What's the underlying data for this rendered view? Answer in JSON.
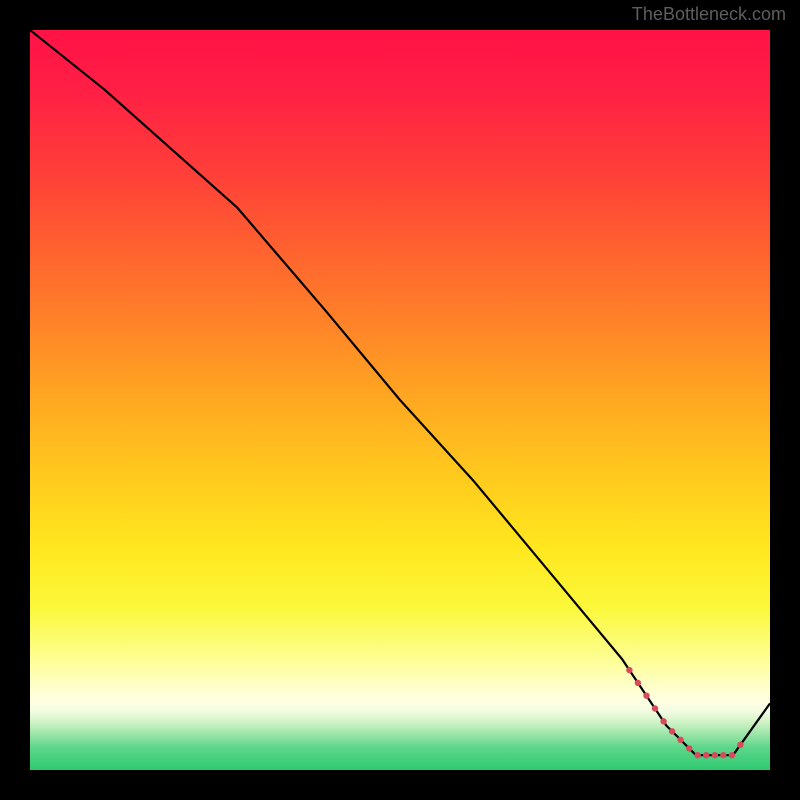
{
  "watermark": "TheBottleneck.com",
  "chart_data": {
    "type": "line",
    "title": "",
    "xlabel": "",
    "ylabel": "",
    "xlim": [
      0,
      100
    ],
    "ylim": [
      0,
      100
    ],
    "note": "Axes unlabeled; values are normalized percentages estimated from pixel positions. Gradient background runs from red (top, high value / high bottleneck) to green (bottom, low value / optimal).",
    "x": [
      0,
      10,
      28,
      40,
      50,
      60,
      70,
      80,
      86,
      90,
      95,
      100
    ],
    "values": [
      100,
      92,
      76,
      62,
      50,
      39,
      27,
      15,
      6,
      2,
      2,
      9
    ],
    "marker_region": {
      "x_start": 81,
      "x_end": 96,
      "description": "cluster of red dot markers along the minimum of the curve"
    }
  }
}
